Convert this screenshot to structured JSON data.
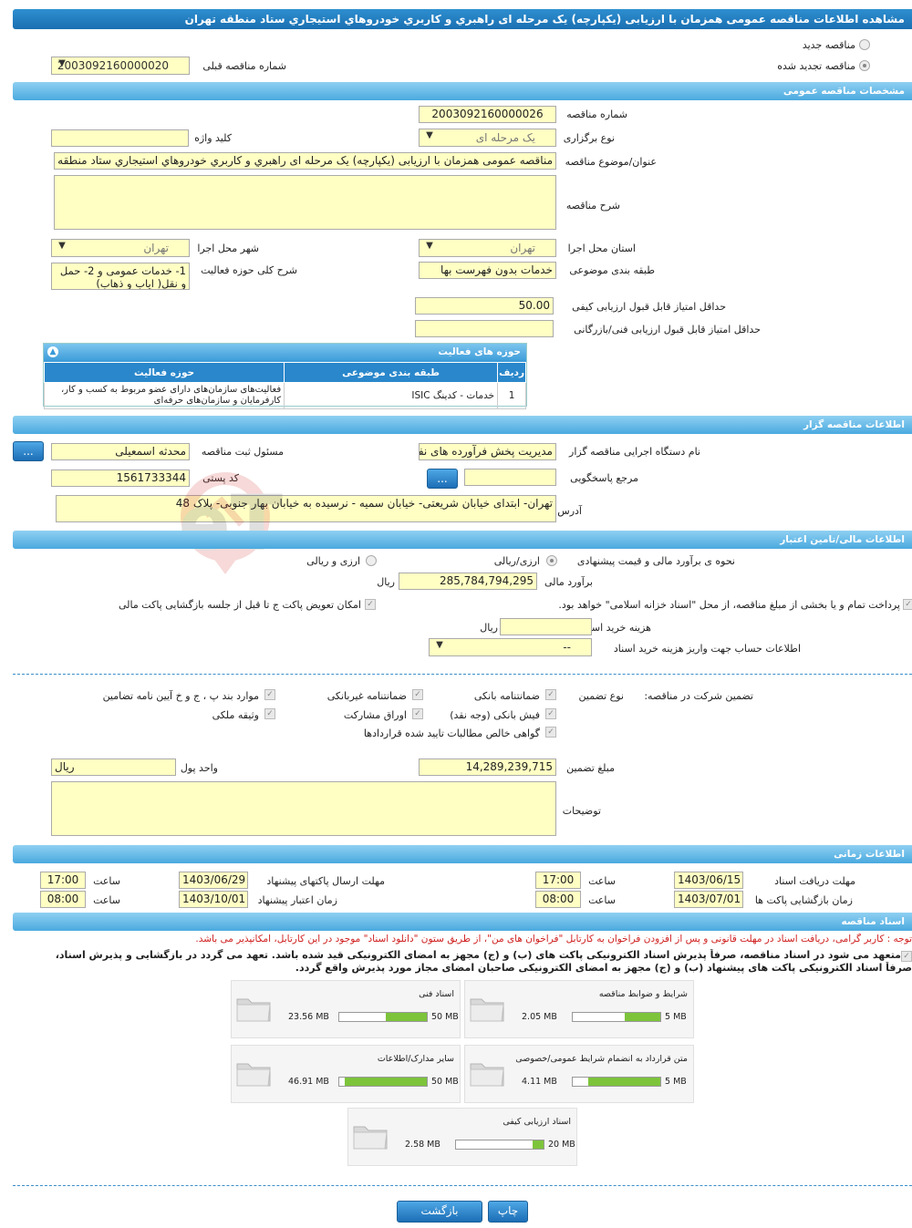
{
  "title": "مشاهده اطلاعات مناقصه عمومی همزمان با ارزیابی (یکپارچه) یک مرحله ای راهبري و کاربري خودروهاي استيجاري ستاد منطقه تهران",
  "top": {
    "new_tender": "مناقصه جدید",
    "renewed_tender": "مناقصه تجدید شده",
    "prev_no_label": "شماره مناقصه قبلی",
    "prev_no": "2003092160000020"
  },
  "general": {
    "header": "مشخصات مناقصه عمومی",
    "tender_no_label": "شماره مناقصه",
    "tender_no": "2003092160000026",
    "holding_type_label": "نوع برگزاری",
    "holding_type": "یک مرحله ای",
    "keyword_label": "کلید واژه",
    "keyword": "",
    "subject_label": "عنوان/موضوع مناقصه",
    "subject": "مناقصه عمومی همزمان با ارزیابی (یکپارچه) یک مرحله ای راهبري و کاربري خودروهاي استيجاري ستاد منطقه تهران",
    "description_label": "شرح مناقصه",
    "description": "",
    "province_label": "استان محل اجرا",
    "province": "تهران",
    "city_label": "شهر محل اجرا",
    "city": "تهران",
    "category_label": "طبقه بندی موضوعی",
    "category": "خدمات بدون فهرست بها",
    "activity_label": "شرح کلی حوزه فعالیت",
    "activity": "1- خدمات عمومی و 2- حمل و نقل( اياب و ذهاب)",
    "min_quality_label": "حداقل امتیاز قابل قبول ارزیابی کیفی",
    "min_quality": "50.00",
    "min_tech_label": "حداقل امتیاز قابل قبول ارزیابی فنی/بازرگانی",
    "min_tech": ""
  },
  "activity_table": {
    "header": "حوزه های فعالیت",
    "columns": [
      "ردیف",
      "طبقه بندی موضوعی",
      "حوزه فعالیت"
    ],
    "rows": [
      [
        "1",
        "خدمات - کدینگ ISIC",
        "فعالیت‌های سازمان‌های دارای عضو مربوط به کسب و کار، کارفرمایان و سازمان‌های حرفه‌ای"
      ]
    ]
  },
  "organizer": {
    "header": "اطلاعات مناقصه گزار",
    "org_label": "نام دستگاه اجرایی مناقصه گزار",
    "org": "مدیریت پخش فرآورده های نفتی منطقه تهران",
    "registrar_label": "مسئول ثبت مناقصه",
    "registrar": "محدثه اسمعیلی",
    "ref_label": "مرجع پاسخگویی",
    "ref": "",
    "postal_label": "کد پستی",
    "postal": "1561733344",
    "address_label": "آدرس",
    "address": "تهران- ابتدای خیابان شریعتی- خیابان سمیه - نرسیده به خیابان بهار جنوبی- پلاک 48",
    "dots": "..."
  },
  "financial": {
    "header": "اطلاعات مالی/تامین اعتبار",
    "estimate_method_label": "نحوه ی برآورد مالی و قیمت پیشنهادی",
    "opt1": "ارزی/ریالی",
    "opt2": "ارزی و ریالی",
    "estimate_label": "برآورد مالی",
    "estimate": "285,784,794,295",
    "rial": "ریال",
    "treasury_text": "پرداخت تمام و یا بخشی از مبلغ مناقصه، از محل \"اسناد خزانه اسلامی\" خواهد بود.",
    "swap_text": "امکان تعویض پاکت ج تا قبل از جلسه بازگشایی پاکت مالی",
    "doc_fee_label": "هزینه خرید اسناد",
    "doc_fee": "",
    "doc_fee_unit": "ریال",
    "account_label": "اطلاعات حساب جهت واریز هزینه خرید اسناد",
    "account": "--"
  },
  "guarantee": {
    "label": "تضمین شرکت در مناقصه:",
    "type_label": "نوع تضمین",
    "items": [
      "ضمانتنامه بانکی",
      "ضمانتنامه غیربانکی",
      "موارد بند پ ، ج و خ آیین نامه تضامین",
      "فیش بانکی (وجه نقد)",
      "اوراق مشارکت",
      "وثیقه ملکی",
      "گواهی خالص مطالبات تایید شده قراردادها"
    ],
    "amount_label": "مبلغ تضمین",
    "amount": "14,289,239,715",
    "currency_label": "واحد پول",
    "currency": "ریال",
    "notes_label": "توضیحات",
    "notes": ""
  },
  "timing": {
    "header": "اطلاعات زمانی",
    "doc_deadline_label": "مهلت دریافت اسناد",
    "doc_deadline": "1403/06/15",
    "doc_time": "17:00",
    "submit_deadline_label": "مهلت ارسال پاکتهای پیشنهاد",
    "submit_deadline": "1403/06/29",
    "submit_time": "17:00",
    "opening_label": "زمان بازگشایی پاکت ها",
    "opening": "1403/07/01",
    "opening_time": "08:00",
    "validity_label": "زمان اعتبار پیشنهاد",
    "validity": "1403/10/01",
    "validity_time": "08:00",
    "time_label": "ساعت"
  },
  "documents": {
    "header": "اسناد مناقصه",
    "notice": "توجه : کاربر گرامی، دریافت اسناد در مهلت قانونی و پس از افزودن فراخوان به کارتابل \"فراخوان های من\"، از طریق ستون \"دانلود اسناد\" موجود در این کارتابل، امکانپذیر می باشد.",
    "commit1": "متعهد می شود در اسناد مناقصه، صرفاً پذیرش اسناد الکترونیکی پاکت های (ب) و (ج) مجهز به امضای الکترونیکی قید شده باشد. تعهد می گردد در بازگشایی و پذیرش اسناد،",
    "commit2": "صرفاً اسناد الکترونیکی پاکت های پیشنهاد (ب) و (ج) مجهز به امضای الکترونیکی صاحبان امضای مجاز مورد پذیرش واقع گردد.",
    "files": [
      {
        "name": "شرایط و ضوابط مناقصه",
        "size": "2.05 MB",
        "max": "5 MB",
        "ratio": 0.41
      },
      {
        "name": "اسناد فنی",
        "size": "23.56 MB",
        "max": "50 MB",
        "ratio": 0.47
      },
      {
        "name": "متن قرارداد به انضمام شرایط عمومی/خصوصی",
        "size": "4.11 MB",
        "max": "5 MB",
        "ratio": 0.82
      },
      {
        "name": "سایر مدارک/اطلاعات",
        "size": "46.91 MB",
        "max": "50 MB",
        "ratio": 0.94
      },
      {
        "name": "اسناد ارزیابی کیفی",
        "size": "2.58 MB",
        "max": "20 MB",
        "ratio": 0.13
      }
    ]
  },
  "actions": {
    "print": "چاپ",
    "back": "بازگشت"
  },
  "watermark": "AriaTender.neT"
}
